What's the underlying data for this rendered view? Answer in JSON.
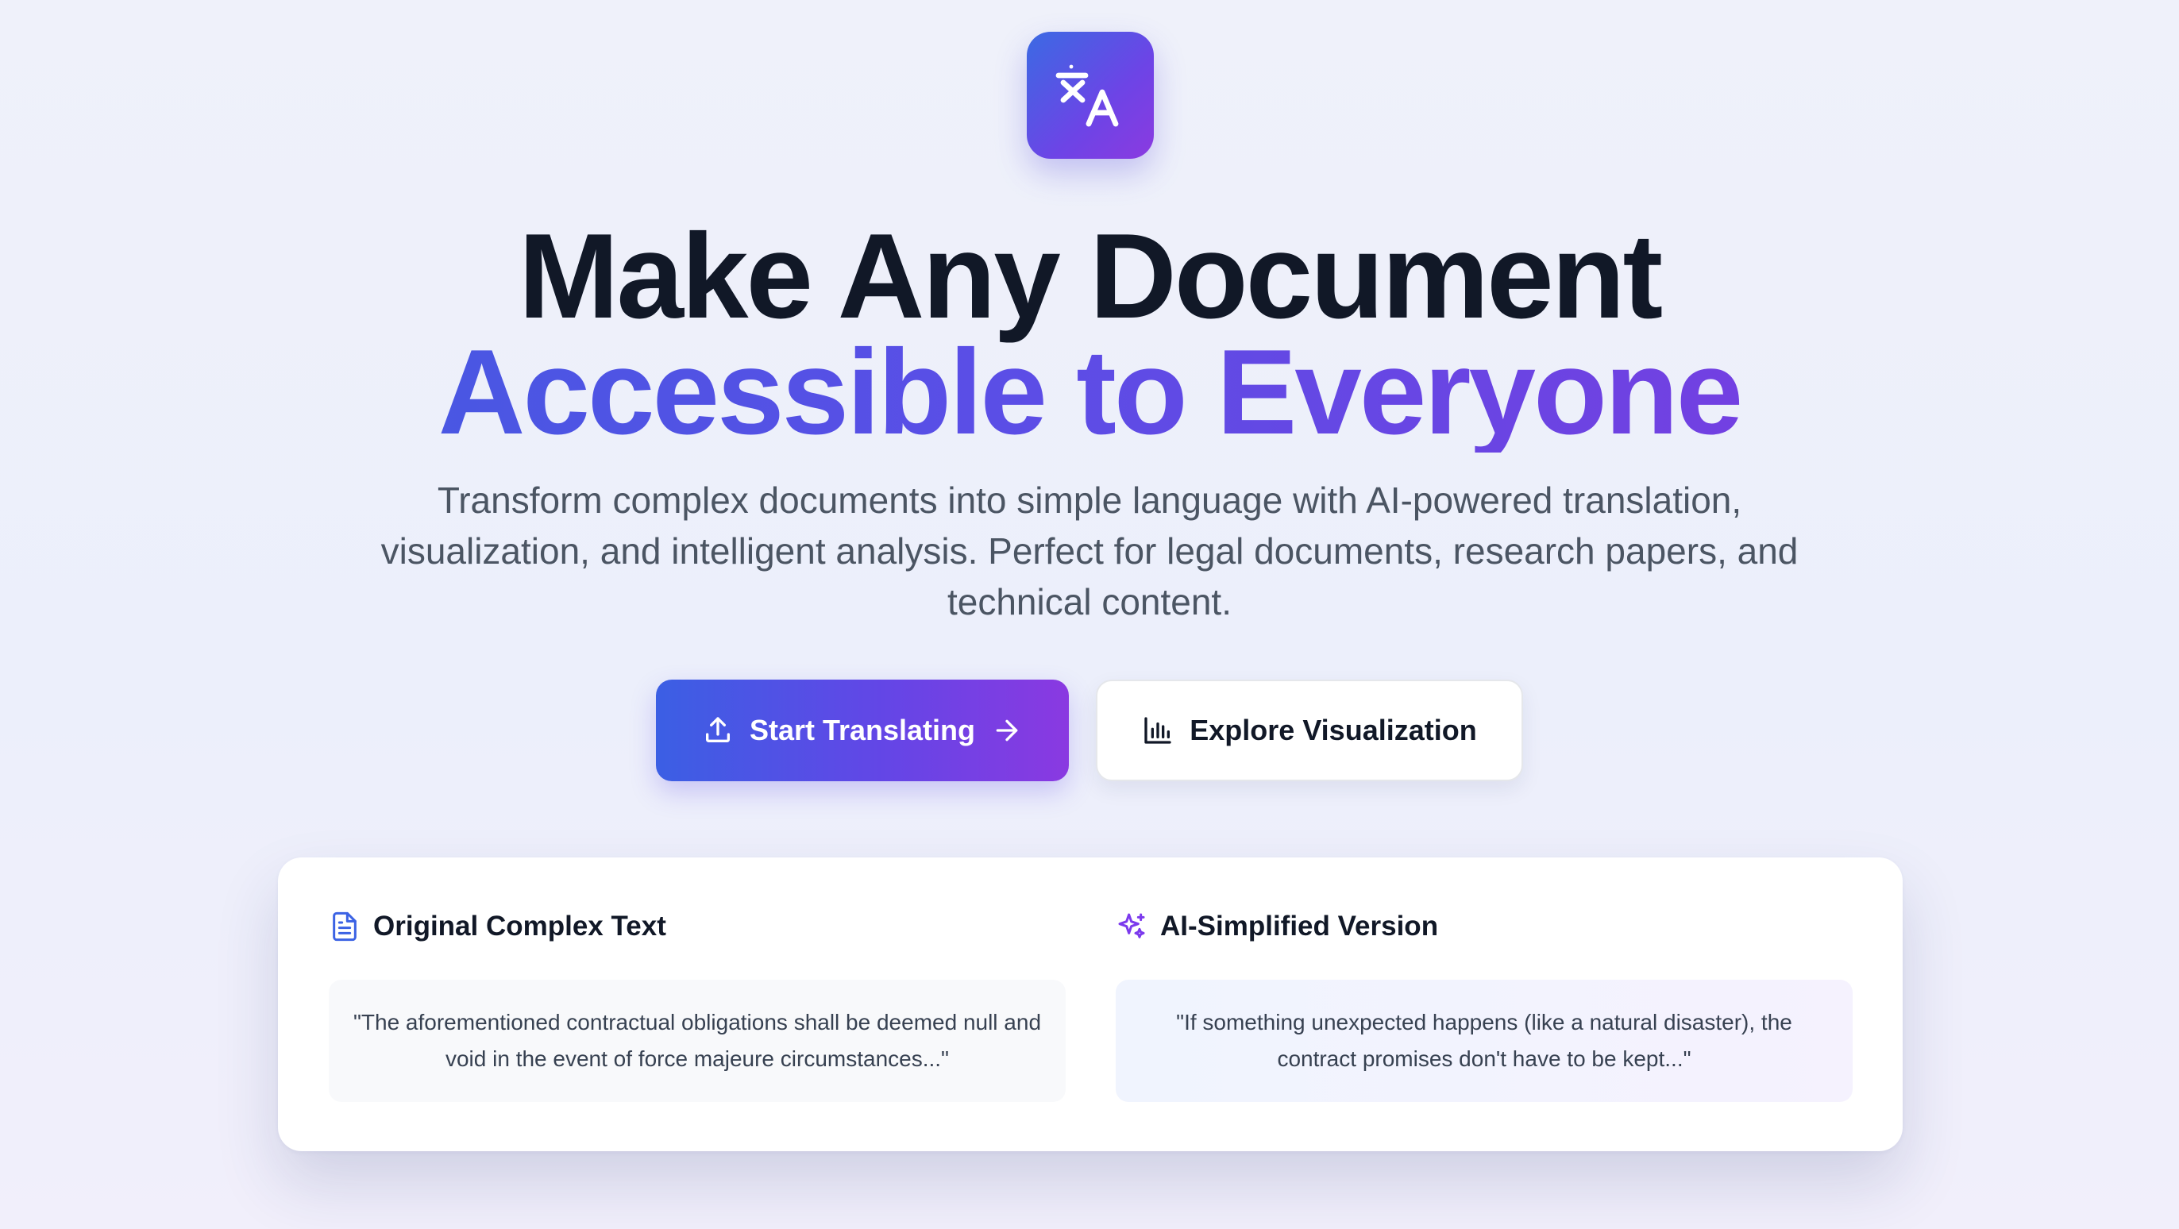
{
  "hero": {
    "headline_line1": "Make Any Document",
    "headline_line2": "Accessible to Everyone",
    "subtitle": "Transform complex documents into simple language with AI-powered translation, visualization, and intelligent analysis. Perfect for legal documents, research papers, and technical content."
  },
  "actions": {
    "primary_label": "Start Translating",
    "primary_icon": "upload-icon",
    "primary_trailing_icon": "arrow-right-icon",
    "secondary_label": "Explore Visualization",
    "secondary_icon": "bar-chart-icon"
  },
  "comparison": {
    "original": {
      "title": "Original Complex Text",
      "icon": "document-icon",
      "text": "\"The aforementioned contractual obligations shall be deemed null and void in the event of force majeure circumstances...\""
    },
    "simplified": {
      "title": "AI-Simplified Version",
      "icon": "sparkles-icon",
      "text": "\"If something unexpected happens (like a natural disaster), the contract promises don't have to be kept...\""
    }
  },
  "logo_icon": "translate-icon",
  "colors": {
    "gradient_start": "#3b62e4",
    "gradient_end": "#8a39e1",
    "heading": "#111827",
    "body_text": "#4b5563"
  }
}
